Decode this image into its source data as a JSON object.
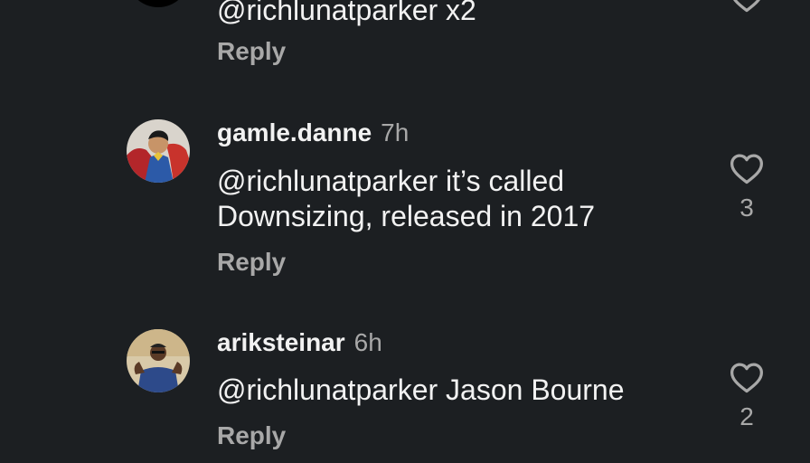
{
  "comments": [
    {
      "text": "@richlunatparker x2",
      "reply_label": "Reply"
    },
    {
      "username": "gamle.danne",
      "time": "7h",
      "text": "@richlunatparker  it’s called Downsizing, released in 2017",
      "reply_label": "Reply",
      "likes": "3"
    },
    {
      "username": "ariksteinar",
      "time": "6h",
      "text": "@richlunatparker Jason Bourne",
      "reply_label": "Reply",
      "likes": "2"
    }
  ],
  "icons": {
    "like": "heart-outline-icon"
  },
  "colors": {
    "background": "#1c1f22",
    "primary_text": "#f2f2f2",
    "secondary_text": "#a8a8a8"
  }
}
